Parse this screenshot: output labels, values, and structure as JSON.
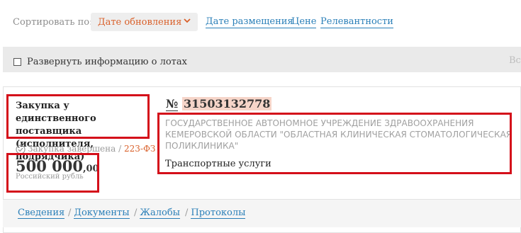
{
  "sort": {
    "label": "Сортировать по:",
    "selected": "Дате обновления",
    "options": [
      "Дате размещения",
      "Цене",
      "Релевантности"
    ]
  },
  "expand": {
    "label": "Развернуть информацию о лотах",
    "right_text": "Все"
  },
  "lot": {
    "procurement_type": "Закупка у единственного поставщика (исполнителя, подрядчика)",
    "status": "Закупка завершена",
    "status_separator": "/",
    "law": "223-ФЗ",
    "price_main": "500 000",
    "price_cents": ",00",
    "currency": "Российский рубль",
    "number_prefix": "№",
    "number": "31503132778",
    "organization": "ГОСУДАРСТВЕННОЕ АВТОНОМНОЕ УЧРЕЖДЕНИЕ ЗДРАВООХРАНЕНИЯ КЕМЕРОВСКОЙ ОБЛАСТИ \"ОБЛАСТНАЯ КЛИНИЧЕСКАЯ СТОМАТОЛОГИЧЕСКАЯ ПОЛИКЛИНИКА\"",
    "subject": "Транспортные услуги"
  },
  "tabs": [
    {
      "label": "Сведения",
      "sep": ""
    },
    {
      "label": "Документы",
      "sep": "/"
    },
    {
      "label": "Жалобы",
      "sep": "/"
    },
    {
      "label": "Протоколы",
      "sep": "/"
    }
  ],
  "colors": {
    "accent_orange": "#d9602a",
    "link_blue": "#2a7fb8",
    "highlight_red_box": "#d40f1a",
    "number_highlight": "#f6d5c9"
  },
  "icons": {
    "sort_dropdown": "chevron-down-icon",
    "status": "check-circle-icon"
  }
}
